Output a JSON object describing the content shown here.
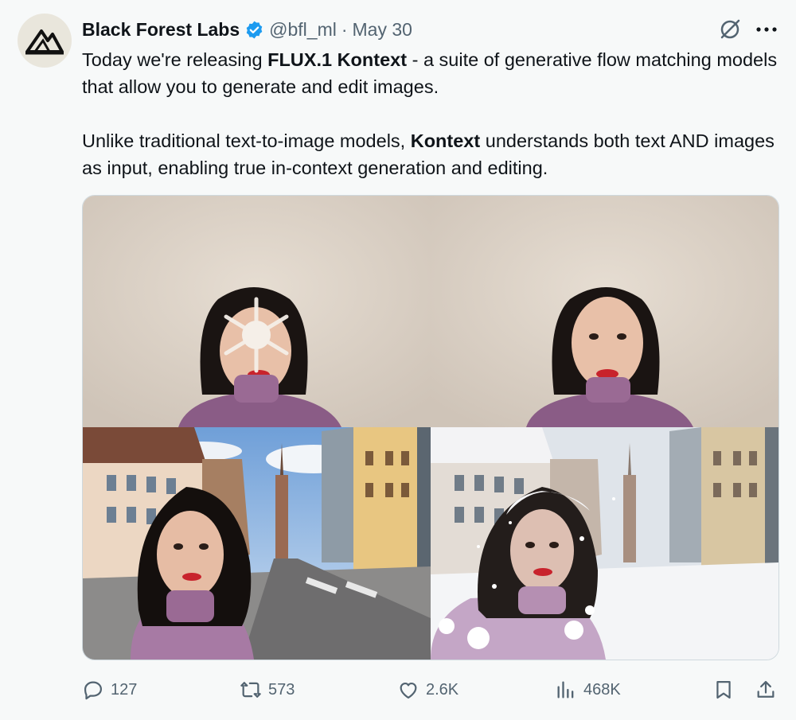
{
  "author": {
    "name": "Black Forest Labs",
    "handle": "@bfl_ml",
    "separator": "·",
    "date": "May 30",
    "verified": true,
    "avatar_icon": "bfl-logo-icon"
  },
  "tweet": {
    "p1_before": "Today we're releasing ",
    "p1_bold": "FLUX.1 Kontext",
    "p1_after": " - a suite of generative flow matching models that allow you to generate and edit images.",
    "p2_before": "Unlike traditional text-to-image models, ",
    "p2_bold": "Kontext",
    "p2_after": " understands both text AND images as input, enabling true in-context generation and editing."
  },
  "media": {
    "panels": [
      {
        "name": "portrait-snowflake-edit"
      },
      {
        "name": "portrait-original"
      },
      {
        "name": "street-selfie-original"
      },
      {
        "name": "street-selfie-snow-edit"
      }
    ]
  },
  "actions": {
    "replies": "127",
    "reposts": "573",
    "likes": "2.6K",
    "views": "468K"
  },
  "colors": {
    "background": "#f7f9f9",
    "text": "#0f1419",
    "secondary": "#536471",
    "verified": "#1d9bf0"
  }
}
